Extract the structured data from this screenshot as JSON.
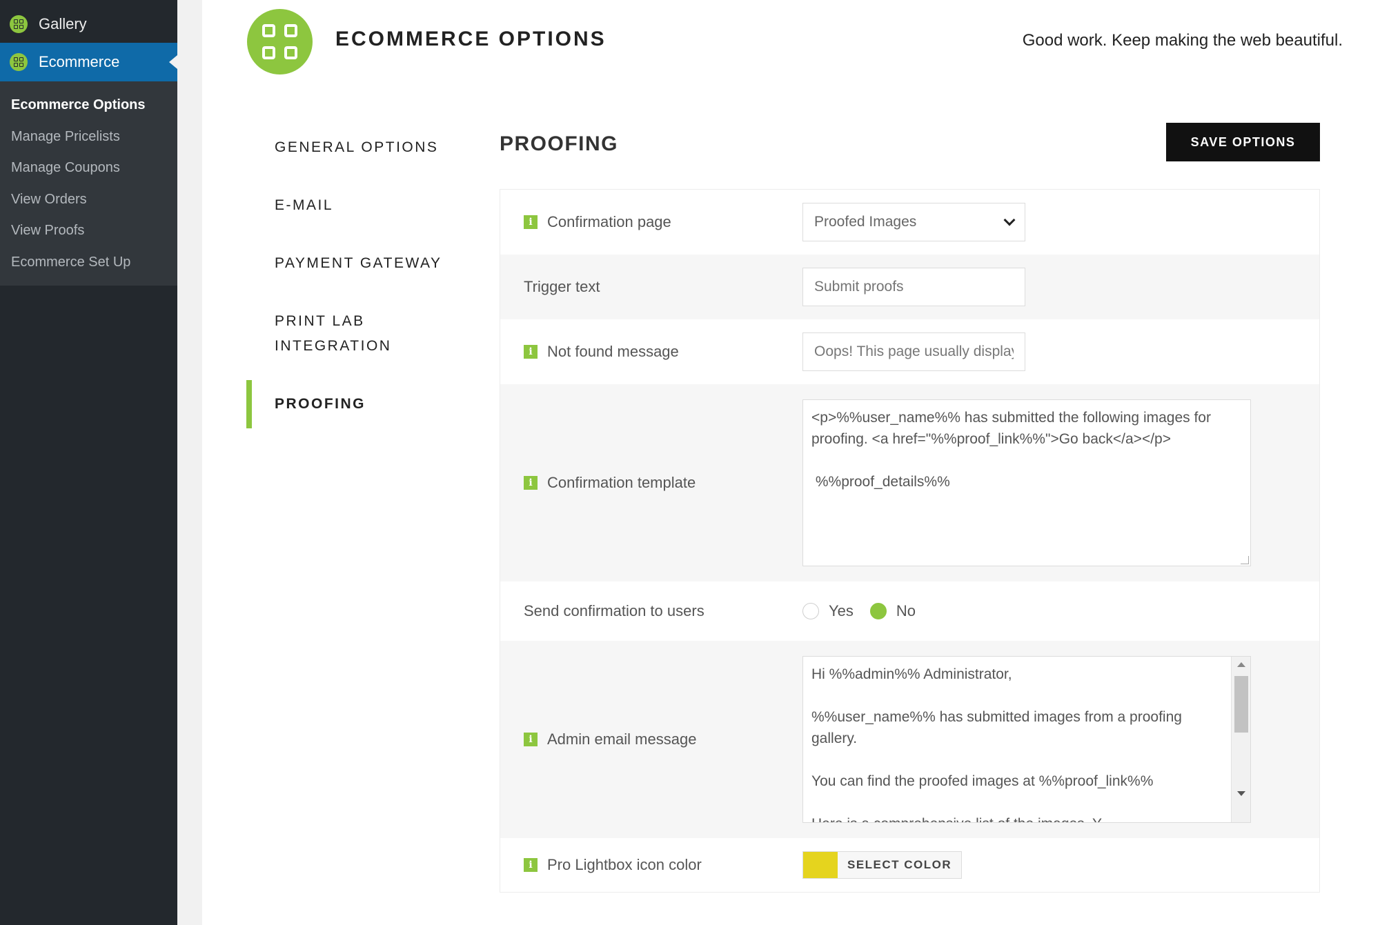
{
  "sidebar": {
    "gallery_label": "Gallery",
    "ecommerce_label": "Ecommerce",
    "submenu": [
      {
        "label": "Ecommerce Options"
      },
      {
        "label": "Manage Pricelists"
      },
      {
        "label": "Manage Coupons"
      },
      {
        "label": "View Orders"
      },
      {
        "label": "View Proofs"
      },
      {
        "label": "Ecommerce Set Up"
      }
    ]
  },
  "header": {
    "title": "ECOMMERCE OPTIONS",
    "tagline": "Good work. Keep making the web beautiful."
  },
  "tabs": [
    {
      "label": "GENERAL OPTIONS"
    },
    {
      "label": "E-MAIL"
    },
    {
      "label": "PAYMENT GATEWAY"
    },
    {
      "label": "PRINT LAB INTEGRATION"
    },
    {
      "label": "PROOFING"
    }
  ],
  "section": {
    "title": "PROOFING",
    "save_label": "SAVE OPTIONS"
  },
  "fields": {
    "confirmation_page": {
      "label": "Confirmation page",
      "value": "Proofed Images"
    },
    "trigger_text": {
      "label": "Trigger text",
      "placeholder": "Submit proofs"
    },
    "not_found": {
      "label": "Not found message",
      "value": "Oops! This page usually displays details"
    },
    "confirmation_template": {
      "label": "Confirmation template",
      "value": "<p>%%user_name%% has submitted the following images for proofing. <a href=\"%%proof_link%%\">Go back</a></p>\n\n %%proof_details%%"
    },
    "send_confirmation": {
      "label": "Send confirmation to users",
      "yes": "Yes",
      "no": "No",
      "selected": "No"
    },
    "admin_email": {
      "label": "Admin email message",
      "value": "Hi %%admin%% Administrator,\n\n%%user_name%% has submitted images from a proofing gallery.\n\nYou can find the proofed images at %%proof_link%%\n\nHere is a comprehensive list of the images. Y"
    },
    "lightbox_color": {
      "label": "Pro Lightbox icon color",
      "button": "SELECT COLOR",
      "color": "#e5d41e"
    }
  },
  "colors": {
    "accent": "#8dc63f",
    "sidebar_bg": "#23282d",
    "sidebar_active": "#0f6aa8"
  }
}
